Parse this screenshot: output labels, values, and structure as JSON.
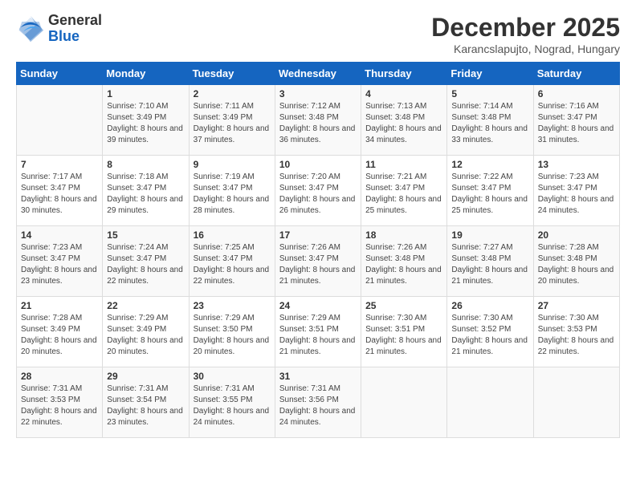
{
  "header": {
    "logo_general": "General",
    "logo_blue": "Blue",
    "month_title": "December 2025",
    "location": "Karancslapujto, Nograd, Hungary"
  },
  "weekdays": [
    "Sunday",
    "Monday",
    "Tuesday",
    "Wednesday",
    "Thursday",
    "Friday",
    "Saturday"
  ],
  "weeks": [
    [
      {
        "day": "",
        "sunrise": "",
        "sunset": "",
        "daylight": ""
      },
      {
        "day": "1",
        "sunrise": "Sunrise: 7:10 AM",
        "sunset": "Sunset: 3:49 PM",
        "daylight": "Daylight: 8 hours and 39 minutes."
      },
      {
        "day": "2",
        "sunrise": "Sunrise: 7:11 AM",
        "sunset": "Sunset: 3:49 PM",
        "daylight": "Daylight: 8 hours and 37 minutes."
      },
      {
        "day": "3",
        "sunrise": "Sunrise: 7:12 AM",
        "sunset": "Sunset: 3:48 PM",
        "daylight": "Daylight: 8 hours and 36 minutes."
      },
      {
        "day": "4",
        "sunrise": "Sunrise: 7:13 AM",
        "sunset": "Sunset: 3:48 PM",
        "daylight": "Daylight: 8 hours and 34 minutes."
      },
      {
        "day": "5",
        "sunrise": "Sunrise: 7:14 AM",
        "sunset": "Sunset: 3:48 PM",
        "daylight": "Daylight: 8 hours and 33 minutes."
      },
      {
        "day": "6",
        "sunrise": "Sunrise: 7:16 AM",
        "sunset": "Sunset: 3:47 PM",
        "daylight": "Daylight: 8 hours and 31 minutes."
      }
    ],
    [
      {
        "day": "7",
        "sunrise": "Sunrise: 7:17 AM",
        "sunset": "Sunset: 3:47 PM",
        "daylight": "Daylight: 8 hours and 30 minutes."
      },
      {
        "day": "8",
        "sunrise": "Sunrise: 7:18 AM",
        "sunset": "Sunset: 3:47 PM",
        "daylight": "Daylight: 8 hours and 29 minutes."
      },
      {
        "day": "9",
        "sunrise": "Sunrise: 7:19 AM",
        "sunset": "Sunset: 3:47 PM",
        "daylight": "Daylight: 8 hours and 28 minutes."
      },
      {
        "day": "10",
        "sunrise": "Sunrise: 7:20 AM",
        "sunset": "Sunset: 3:47 PM",
        "daylight": "Daylight: 8 hours and 26 minutes."
      },
      {
        "day": "11",
        "sunrise": "Sunrise: 7:21 AM",
        "sunset": "Sunset: 3:47 PM",
        "daylight": "Daylight: 8 hours and 25 minutes."
      },
      {
        "day": "12",
        "sunrise": "Sunrise: 7:22 AM",
        "sunset": "Sunset: 3:47 PM",
        "daylight": "Daylight: 8 hours and 25 minutes."
      },
      {
        "day": "13",
        "sunrise": "Sunrise: 7:23 AM",
        "sunset": "Sunset: 3:47 PM",
        "daylight": "Daylight: 8 hours and 24 minutes."
      }
    ],
    [
      {
        "day": "14",
        "sunrise": "Sunrise: 7:23 AM",
        "sunset": "Sunset: 3:47 PM",
        "daylight": "Daylight: 8 hours and 23 minutes."
      },
      {
        "day": "15",
        "sunrise": "Sunrise: 7:24 AM",
        "sunset": "Sunset: 3:47 PM",
        "daylight": "Daylight: 8 hours and 22 minutes."
      },
      {
        "day": "16",
        "sunrise": "Sunrise: 7:25 AM",
        "sunset": "Sunset: 3:47 PM",
        "daylight": "Daylight: 8 hours and 22 minutes."
      },
      {
        "day": "17",
        "sunrise": "Sunrise: 7:26 AM",
        "sunset": "Sunset: 3:47 PM",
        "daylight": "Daylight: 8 hours and 21 minutes."
      },
      {
        "day": "18",
        "sunrise": "Sunrise: 7:26 AM",
        "sunset": "Sunset: 3:48 PM",
        "daylight": "Daylight: 8 hours and 21 minutes."
      },
      {
        "day": "19",
        "sunrise": "Sunrise: 7:27 AM",
        "sunset": "Sunset: 3:48 PM",
        "daylight": "Daylight: 8 hours and 21 minutes."
      },
      {
        "day": "20",
        "sunrise": "Sunrise: 7:28 AM",
        "sunset": "Sunset: 3:48 PM",
        "daylight": "Daylight: 8 hours and 20 minutes."
      }
    ],
    [
      {
        "day": "21",
        "sunrise": "Sunrise: 7:28 AM",
        "sunset": "Sunset: 3:49 PM",
        "daylight": "Daylight: 8 hours and 20 minutes."
      },
      {
        "day": "22",
        "sunrise": "Sunrise: 7:29 AM",
        "sunset": "Sunset: 3:49 PM",
        "daylight": "Daylight: 8 hours and 20 minutes."
      },
      {
        "day": "23",
        "sunrise": "Sunrise: 7:29 AM",
        "sunset": "Sunset: 3:50 PM",
        "daylight": "Daylight: 8 hours and 20 minutes."
      },
      {
        "day": "24",
        "sunrise": "Sunrise: 7:29 AM",
        "sunset": "Sunset: 3:51 PM",
        "daylight": "Daylight: 8 hours and 21 minutes."
      },
      {
        "day": "25",
        "sunrise": "Sunrise: 7:30 AM",
        "sunset": "Sunset: 3:51 PM",
        "daylight": "Daylight: 8 hours and 21 minutes."
      },
      {
        "day": "26",
        "sunrise": "Sunrise: 7:30 AM",
        "sunset": "Sunset: 3:52 PM",
        "daylight": "Daylight: 8 hours and 21 minutes."
      },
      {
        "day": "27",
        "sunrise": "Sunrise: 7:30 AM",
        "sunset": "Sunset: 3:53 PM",
        "daylight": "Daylight: 8 hours and 22 minutes."
      }
    ],
    [
      {
        "day": "28",
        "sunrise": "Sunrise: 7:31 AM",
        "sunset": "Sunset: 3:53 PM",
        "daylight": "Daylight: 8 hours and 22 minutes."
      },
      {
        "day": "29",
        "sunrise": "Sunrise: 7:31 AM",
        "sunset": "Sunset: 3:54 PM",
        "daylight": "Daylight: 8 hours and 23 minutes."
      },
      {
        "day": "30",
        "sunrise": "Sunrise: 7:31 AM",
        "sunset": "Sunset: 3:55 PM",
        "daylight": "Daylight: 8 hours and 24 minutes."
      },
      {
        "day": "31",
        "sunrise": "Sunrise: 7:31 AM",
        "sunset": "Sunset: 3:56 PM",
        "daylight": "Daylight: 8 hours and 24 minutes."
      },
      {
        "day": "",
        "sunrise": "",
        "sunset": "",
        "daylight": ""
      },
      {
        "day": "",
        "sunrise": "",
        "sunset": "",
        "daylight": ""
      },
      {
        "day": "",
        "sunrise": "",
        "sunset": "",
        "daylight": ""
      }
    ]
  ]
}
